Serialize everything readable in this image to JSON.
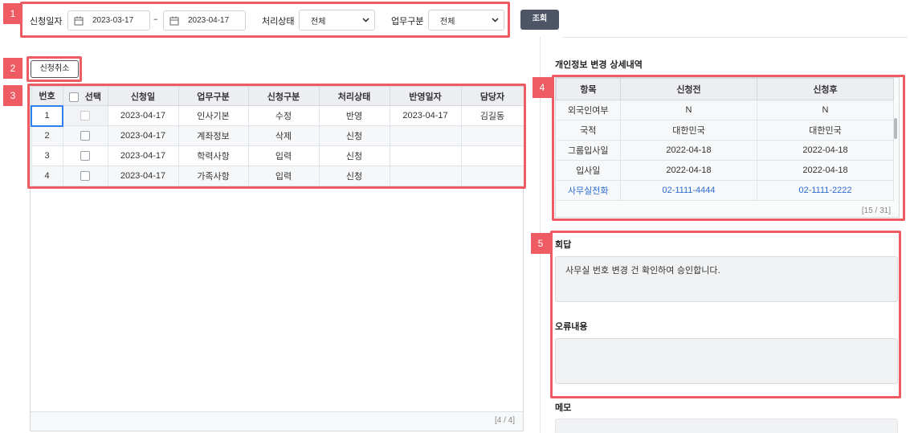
{
  "filter": {
    "date_label": "신청일자",
    "date_from": "2023-03-17",
    "date_sep": "–",
    "date_to": "2023-04-17",
    "status_label": "처리상태",
    "status_value": "전체",
    "work_label": "업무구분",
    "work_value": "전체",
    "search_button": "조회"
  },
  "actions": {
    "cancel_button": "신청취소"
  },
  "grid": {
    "columns": [
      "번호",
      "선택",
      "신청일",
      "업무구분",
      "신청구분",
      "처리상태",
      "반영일자",
      "담당자"
    ],
    "rows": [
      {
        "no": "1",
        "date": "2023-04-17",
        "work": "인사기본",
        "type": "수정",
        "status": "반영",
        "applied": "2023-04-17",
        "owner": "김길동"
      },
      {
        "no": "2",
        "date": "2023-04-17",
        "work": "계좌정보",
        "type": "삭제",
        "status": "신청",
        "applied": "",
        "owner": ""
      },
      {
        "no": "3",
        "date": "2023-04-17",
        "work": "학력사항",
        "type": "입력",
        "status": "신청",
        "applied": "",
        "owner": ""
      },
      {
        "no": "4",
        "date": "2023-04-17",
        "work": "가족사항",
        "type": "입력",
        "status": "신청",
        "applied": "",
        "owner": ""
      }
    ],
    "pager": "[4 / 4]"
  },
  "detail": {
    "title": "개인정보 변경 상세내역",
    "columns": [
      "항목",
      "신청전",
      "신청후"
    ],
    "rows": [
      {
        "item": "외국인여부",
        "before": "N",
        "after": "N"
      },
      {
        "item": "국적",
        "before": "대한민국",
        "after": "대한민국"
      },
      {
        "item": "그룹입사일",
        "before": "2022-04-18",
        "after": "2022-04-18"
      },
      {
        "item": "입사일",
        "before": "2022-04-18",
        "after": "2022-04-18"
      },
      {
        "item": "사무실전화",
        "before": "02-1111-4444",
        "after": "02-1111-2222"
      }
    ],
    "pager": "[15 / 31]"
  },
  "answer": {
    "title": "회답",
    "text": "사무실 번호 변경 건 확인하여 승인합니다."
  },
  "error": {
    "title": "오류내용",
    "text": ""
  },
  "memo": {
    "title": "메모"
  },
  "badges": [
    "1",
    "2",
    "3",
    "4",
    "5"
  ],
  "colors": {
    "highlight": "#ef5b63",
    "button_dark": "#4d5566",
    "link": "#2a6bd1",
    "selection": "#2f80ed"
  }
}
